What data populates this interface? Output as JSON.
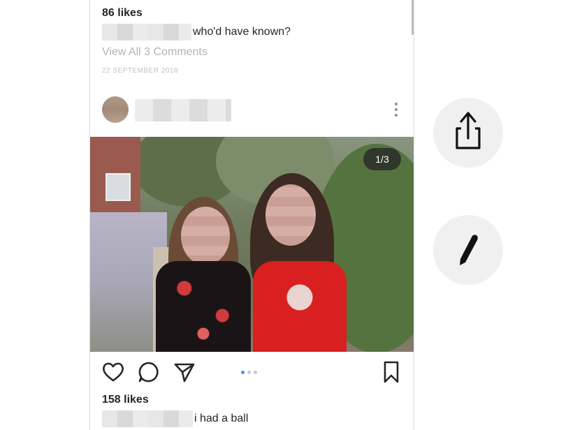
{
  "post_previous": {
    "likes": "86 likes",
    "caption": "who'd have known?",
    "view_comments": "View All 3 Comments",
    "date": "22 SEPTEMBER 2018"
  },
  "post_current": {
    "image_counter": "1/3",
    "likes": "158 likes",
    "caption": "i had a ball",
    "carousel_pages": 3,
    "carousel_current": 1
  },
  "icons": {
    "more": "more-vertical-icon",
    "like": "heart-icon",
    "comment": "comment-icon",
    "share": "send-icon",
    "save": "bookmark-icon",
    "side_share": "share-icon",
    "side_edit": "pencil-icon"
  },
  "colors": {
    "text": "#262626",
    "muted": "#b3b3b3",
    "accent": "#3897f0",
    "side_button_bg": "#f0f0f0"
  }
}
